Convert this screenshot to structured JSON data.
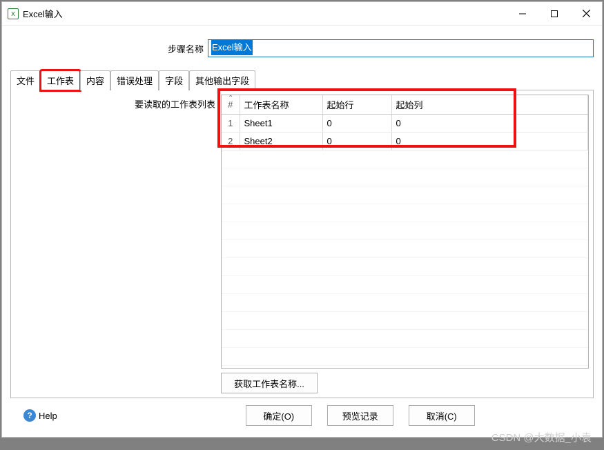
{
  "window": {
    "title": "Excel输入"
  },
  "step": {
    "label": "步骤名称",
    "value": "Excel输入"
  },
  "tabs": [
    {
      "label": "文件"
    },
    {
      "label": "工作表"
    },
    {
      "label": "内容"
    },
    {
      "label": "错误处理"
    },
    {
      "label": "字段"
    },
    {
      "label": "其他输出字段"
    }
  ],
  "panel": {
    "list_label": "要读取的工作表列表",
    "columns": {
      "idx": "#",
      "name": "工作表名称",
      "start_row": "起始行",
      "start_col": "起始列"
    },
    "rows": [
      {
        "idx": "1",
        "name": "Sheet1",
        "start_row": "0",
        "start_col": "0"
      },
      {
        "idx": "2",
        "name": "Sheet2",
        "start_row": "0",
        "start_col": "0"
      }
    ],
    "get_sheets_btn": "获取工作表名称..."
  },
  "footer": {
    "help": "Help",
    "ok": "确定(O)",
    "preview": "预览记录",
    "cancel": "取消(C)"
  },
  "watermark": "CSDN @大数据_小袁"
}
